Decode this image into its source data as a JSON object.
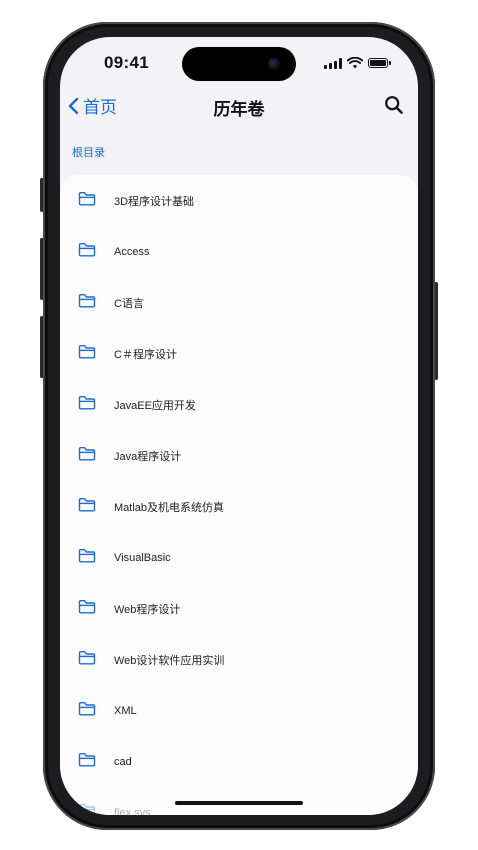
{
  "status_bar": {
    "time": "09:41"
  },
  "nav": {
    "back_label": "首页",
    "title": "历年卷"
  },
  "breadcrumb": "根目录",
  "folders": [
    "3D程序设计基础",
    "Access",
    "C语言",
    "C＃程序设计",
    "JavaEE应用开发",
    "Java程序设计",
    "Matlab及机电系统仿真",
    "VisualBasic",
    "Web程序设计",
    "Web设计软件应用实训",
    "XML",
    "cad",
    "flex sys"
  ],
  "colors": {
    "accent": "#1a6bd6",
    "text": "#222222",
    "background": "#f3f3f5",
    "list_background": "#fcfcfd"
  },
  "icons": {
    "back": "chevron-left-icon",
    "search": "search-icon",
    "folder": "folder-icon"
  }
}
